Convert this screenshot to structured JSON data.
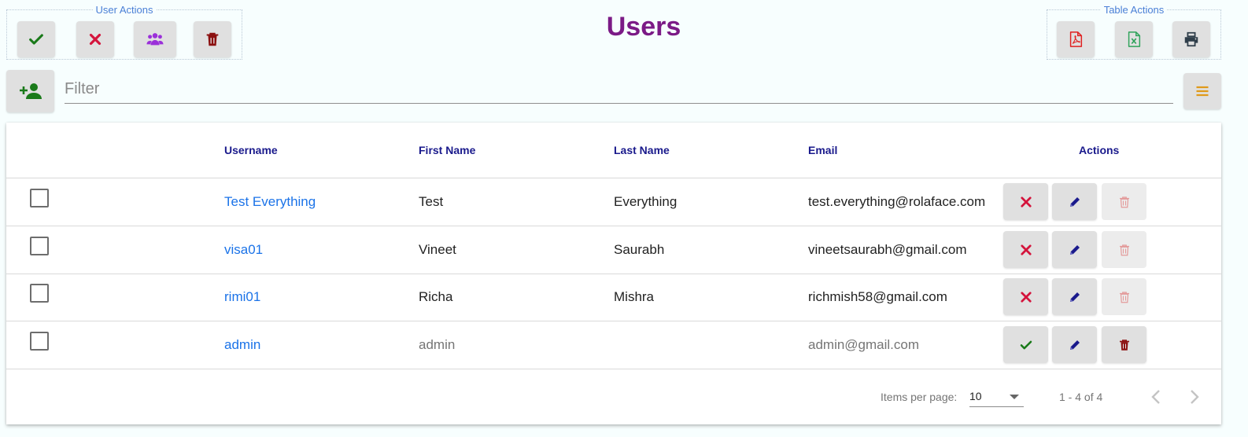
{
  "header": {
    "title": "Users",
    "user_actions_legend": "User Actions",
    "table_actions_legend": "Table Actions"
  },
  "user_actions": [
    {
      "name": "approve-users-button",
      "icon": "check-icon",
      "color": "#1a7a1a"
    },
    {
      "name": "reject-users-button",
      "icon": "close-icon",
      "color": "#d4143c"
    },
    {
      "name": "group-users-button",
      "icon": "users-group-icon",
      "color": "#9b30d9"
    },
    {
      "name": "delete-users-button",
      "icon": "trash-icon",
      "color": "#8b1010"
    }
  ],
  "table_actions": [
    {
      "name": "export-pdf-button",
      "icon": "pdf-file-icon",
      "color": "#e02020"
    },
    {
      "name": "export-excel-button",
      "icon": "excel-file-icon",
      "color": "#2fa35a"
    },
    {
      "name": "print-button",
      "icon": "print-icon",
      "color": "#2f3e4a"
    }
  ],
  "filter": {
    "placeholder": "Filter",
    "value": "",
    "add_user_icon": "add-user-icon",
    "menu_icon": "menu-icon",
    "add_user_color": "#1a7a1a",
    "menu_color": "#e09a1a"
  },
  "table": {
    "columns": [
      "Username",
      "First Name",
      "Last Name",
      "Email",
      "Actions"
    ],
    "rows": [
      {
        "username": "Test Everything",
        "first_name": "Test",
        "last_name": "Everything",
        "email": "test.everything@rolaface.com",
        "status_action": "close-icon",
        "delete_enabled": false,
        "muted": false
      },
      {
        "username": "visa01",
        "first_name": "Vineet",
        "last_name": "Saurabh",
        "email": "vineetsaurabh@gmail.com",
        "status_action": "close-icon",
        "delete_enabled": false,
        "muted": false
      },
      {
        "username": "rimi01",
        "first_name": "Richa",
        "last_name": "Mishra",
        "email": "richmish58@gmail.com",
        "status_action": "close-icon",
        "delete_enabled": false,
        "muted": false
      },
      {
        "username": "admin",
        "first_name": "admin",
        "last_name": "",
        "email": "admin@gmail.com",
        "status_action": "check-icon",
        "delete_enabled": true,
        "muted": true
      }
    ]
  },
  "paginator": {
    "items_per_page_label": "Items per page:",
    "page_size": "10",
    "range_label": "1 - 4 of 4"
  }
}
